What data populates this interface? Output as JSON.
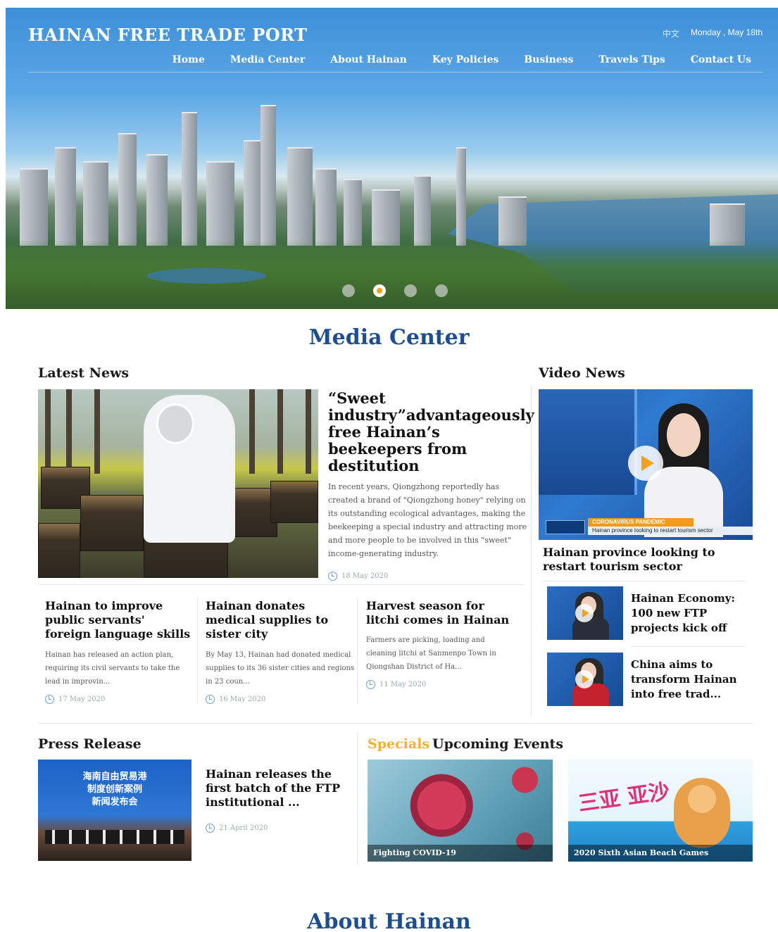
{
  "header": {
    "brand": "HAINAN FREE TRADE PORT",
    "lang": "中文",
    "date": "Monday , May 18th",
    "nav": [
      "Home",
      "Media Center",
      "About Hainan",
      "Key Policies",
      "Business",
      "Travels Tips",
      "Contact Us"
    ]
  },
  "carousel": {
    "count": 4,
    "active_index": 2
  },
  "media_center": {
    "title": "Media Center",
    "latest": {
      "heading": "Latest News",
      "featured": {
        "title": "“Sweet industry”advantageously free Hainan’s beekeepers from destitution",
        "summary": "In recent years, Qiongzhong reportedly has created a brand of \"Qiongzhong honey\" relying on its outstanding ecological advantages, making the beekeeping a special industry and attracting more and more people to be involved in this \"sweet\" income-generating industry.",
        "date": "18 May 2020"
      },
      "items": [
        {
          "title": "Hainan to improve public servants' foreign language skills",
          "summary": "Hainan has released an action plan, requiring its civil servants to take the lead in improvin...",
          "date": "17 May 2020"
        },
        {
          "title": "Hainan donates medical supplies to sister city",
          "summary": "By May 13, Hainan had donated medical supplies to its 36 sister cities and regions in 23 coun...",
          "date": "16 May 2020"
        },
        {
          "title": "Harvest season for litchi comes in Hainan",
          "summary": "Farmers are picking, loading and cleaning litchi at Sanmenpo Town in Qiongshan District of Ha...",
          "date": "11 May 2020"
        }
      ]
    },
    "video": {
      "heading": "Video News",
      "main": {
        "title": "Hainan province looking to restart tourism sector",
        "banner_top": "CORONAVIRUS PANDEMIC",
        "banner_bottom": "Hainan province looking to restart tourism sector"
      },
      "items": [
        {
          "title": "Hainan Economy: 100 new FTP projects kick off"
        },
        {
          "title": "China aims to transform Hainan into free trad..."
        }
      ]
    },
    "press": {
      "heading": "Press Release",
      "image_text": "海南自由贸易港\n制度创新案例\n新闻发布会",
      "title": "Hainan releases the first batch of the FTP institutional ...",
      "date": "21 April 2020"
    },
    "specials": {
      "tab_specials": "Specials",
      "tab_events": "Upcoming Events",
      "cards": [
        {
          "caption": "Fighting COVID-19"
        },
        {
          "caption": "2020 Sixth Asian Beach Games",
          "art_text": "三亚 亚沙"
        }
      ]
    }
  },
  "about": {
    "title": "About Hainan"
  },
  "colors": {
    "accent_blue": "#1d4e92",
    "orange": "#f0a21c",
    "specials_gold": "#f2b130"
  }
}
